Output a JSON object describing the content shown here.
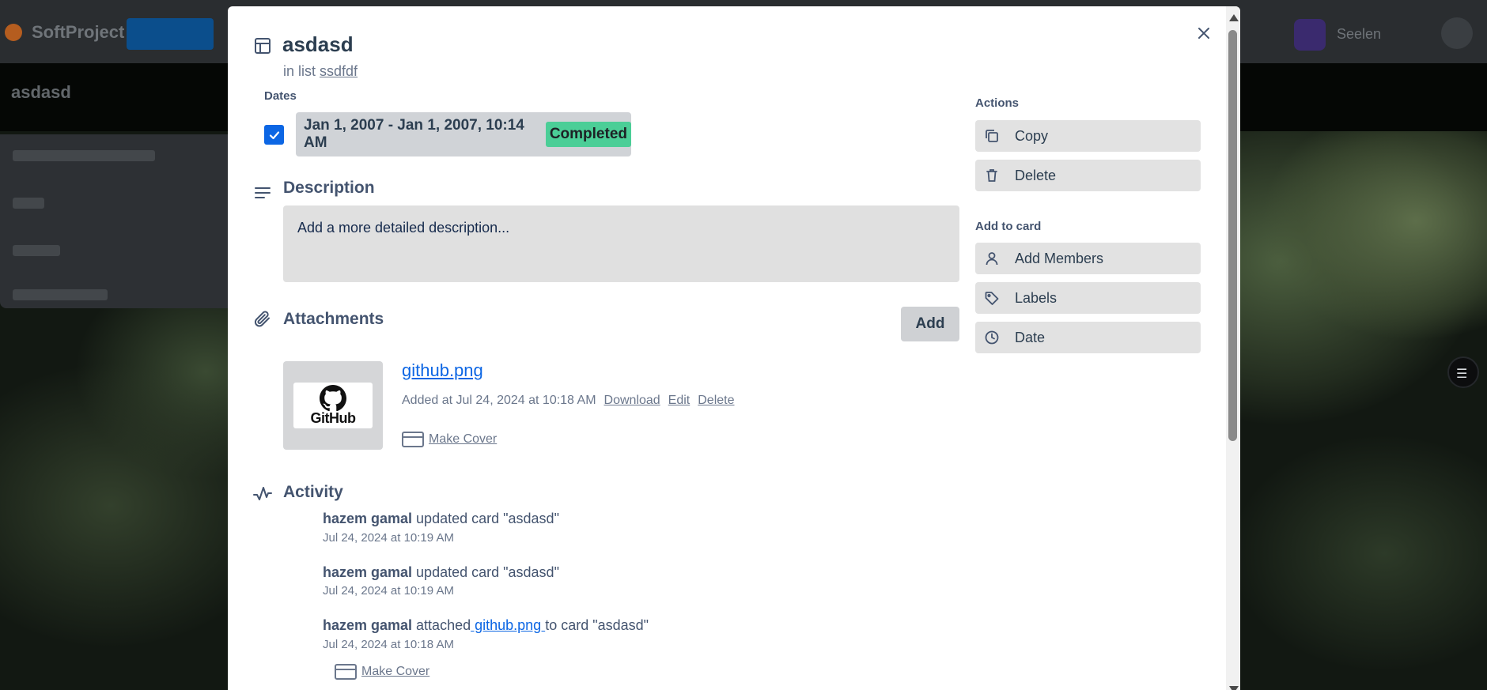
{
  "background": {
    "app_name": "SoftProject",
    "board_name": "asdasd",
    "workspace_name": "Seelen"
  },
  "card": {
    "title": "asdasd",
    "in_list_prefix": "in list",
    "list_name": "ssdfdf"
  },
  "dates": {
    "label": "Dates",
    "range": "Jan 1, 2007 - Jan 1, 2007, 10:14 AM",
    "status": "Completed",
    "checked": true
  },
  "description": {
    "title": "Description",
    "placeholder": "Add a more detailed description..."
  },
  "attachments": {
    "title": "Attachments",
    "add_label": "Add",
    "items": [
      {
        "thumb_text": "GitHub",
        "name": "github.png",
        "added": "Added at Jul 24, 2024 at 10:18 AM",
        "download_label": "Download",
        "edit_label": "Edit",
        "delete_label": "Delete",
        "make_cover_label": "Make Cover"
      }
    ]
  },
  "activity": {
    "title": "Activity",
    "items": [
      {
        "user": "hazem gamal",
        "text": " updated card \"asdasd\"",
        "time": "Jul 24, 2024 at 10:19 AM"
      },
      {
        "user": "hazem gamal",
        "text": " updated card \"asdasd\"",
        "time": "Jul 24, 2024 at 10:19 AM"
      },
      {
        "user": "hazem gamal",
        "text_before": " attached",
        "link": " github.png ",
        "text_after": "to card \"asdasd\"",
        "time": "Jul 24, 2024 at 10:18 AM",
        "make_cover_label": "Make Cover"
      }
    ]
  },
  "sidebar": {
    "actions_label": "Actions",
    "copy_label": "Copy",
    "delete_label": "Delete",
    "add_to_card_label": "Add to card",
    "add_members_label": "Add Members",
    "labels_label": "Labels",
    "date_label": "Date"
  },
  "colors": {
    "accent": "#0c66e4",
    "completed": "#4bce97"
  }
}
